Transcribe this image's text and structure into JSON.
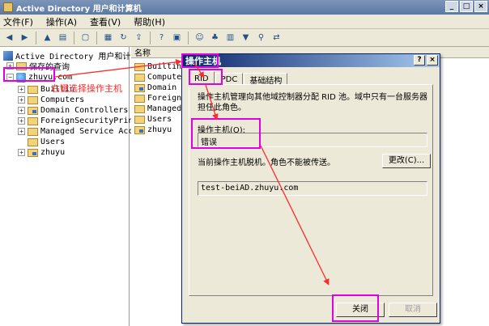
{
  "window": {
    "title": "Active Directory 用户和计算机",
    "controls": [
      "_",
      "□",
      "×"
    ]
  },
  "menu": [
    "文件(F)",
    "操作(A)",
    "查看(V)",
    "帮助(H)"
  ],
  "toolbar_icons": [
    "back-icon",
    "forward-icon",
    "up-folder-icon",
    "tree-icon",
    "delete-icon",
    "properties-icon",
    "refresh-icon",
    "export-icon",
    "help-icon",
    "console-icon",
    "users-icon",
    "group-icon",
    "new-folder-icon",
    "filter-icon",
    "search-icon",
    "move-icon"
  ],
  "tree": {
    "root_label": "Active Directory 用户和计算机",
    "saved_queries": "保存的查询",
    "domain": "zhuyu.com",
    "children": [
      "Builtin",
      "Computers",
      "Domain Controllers",
      "ForeignSecurityPrincip",
      "Managed Service Accour",
      "Users",
      "zhuyu"
    ]
  },
  "list": {
    "header": "名称",
    "items": [
      "Builtin",
      "Computers",
      "Domain Co",
      "ForeignSe",
      "Managed S",
      "Users",
      "zhuyu"
    ]
  },
  "annotation": {
    "text": "右键选择操作主机",
    "color": "#ff2a2a",
    "highlight_color": "#e000e0"
  },
  "dialog": {
    "title": "操作主机",
    "help_button": "?",
    "close_x": "×",
    "tabs": [
      "RID",
      "PDC",
      "基础结构"
    ],
    "active_tab": "RID",
    "description": "操作主机管理向其他域控制器分配 RID 池。域中只有一台服务器担任此角色。",
    "operations_master_label": "操作主机(O):",
    "operations_master_value": "错误",
    "offline_text": "当前操作主机脱机。角色不能被传送。",
    "change_button": "更改(C)...",
    "dc_value": "test-beiAD.zhuyu.com",
    "close_button": "关闭",
    "cancel_button": "取消"
  }
}
